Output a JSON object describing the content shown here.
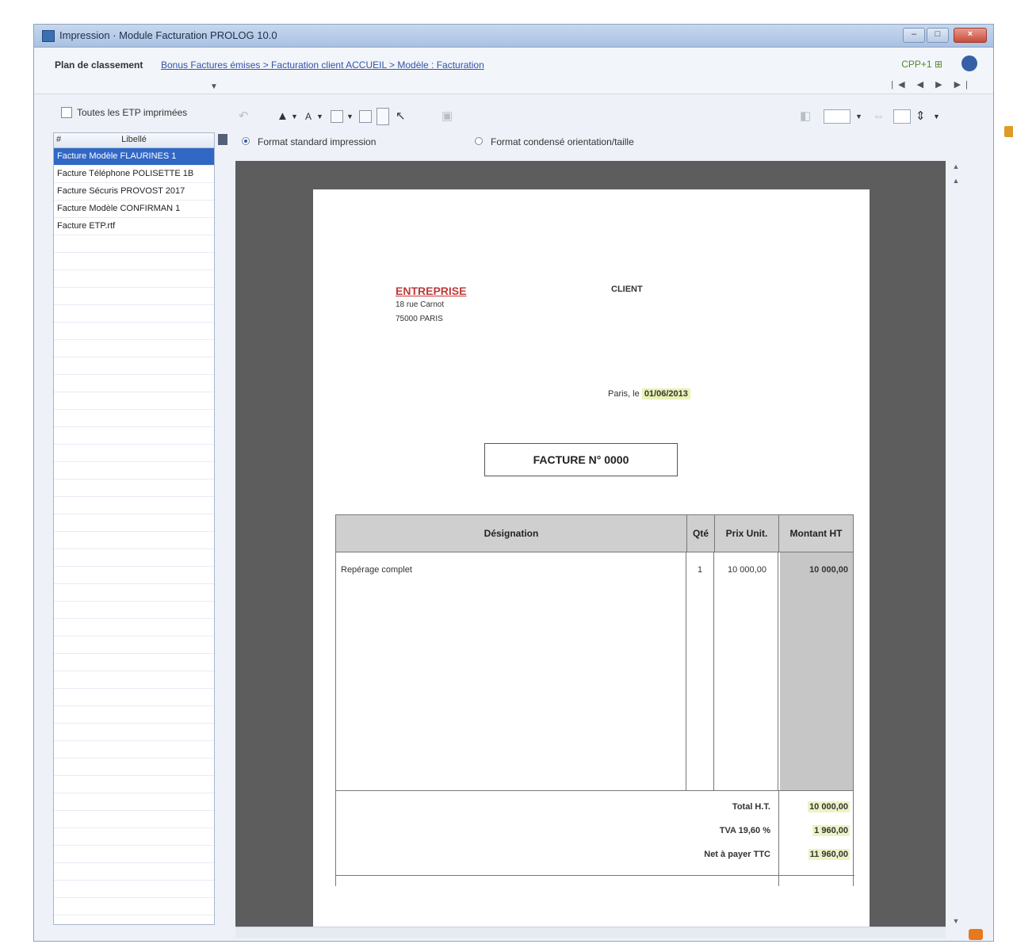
{
  "window": {
    "title": "Impression · Module Facturation PROLOG 10.0",
    "min_glyph": "–",
    "max_glyph": "□",
    "close_glyph": "×"
  },
  "topbar": {
    "label": "Plan de classement",
    "links": "Bonus Factures émises > Facturation client ACCUEIL > Modèle : Facturation",
    "right_text": "CPP+1 ⊞",
    "pager": "|◀ ◀ ▶ ▶|"
  },
  "sidebar": {
    "checkbox_label": "Toutes les ETP imprimées",
    "checkbox_checked": false,
    "header_index": "#",
    "header_label": "Libellé",
    "items": [
      {
        "label": "Facture Modèle FLAURINES 1",
        "selected": true
      },
      {
        "label": "Facture Téléphone POLISETTE 1B",
        "selected": false
      },
      {
        "label": "Facture Sécuris PROVOST 2017",
        "selected": false
      },
      {
        "label": "Facture Modèle CONFIRMAN 1",
        "selected": false
      },
      {
        "label": "Facture ETP.rtf",
        "selected": false
      }
    ]
  },
  "toolbar": {
    "radio1_label": "Format standard impression",
    "radio2_label": "Format condensé orientation/taille",
    "radio1_selected": true
  },
  "document": {
    "company_name": "ENTREPRISE",
    "company_addr1": "18 rue Carnot",
    "company_addr2": "75000 PARIS",
    "client_label": "CLIENT",
    "city_prefix": "Paris, le",
    "date": "01/06/2013",
    "invoice_title": "FACTURE N° 0000",
    "table": {
      "headers": [
        "Désignation",
        "Qté",
        "Prix Unit.",
        "Montant HT"
      ],
      "rows": [
        {
          "designation": "Repérage complet",
          "qty": "1",
          "unit_price": "10 000,00",
          "amount": "10 000,00"
        }
      ]
    },
    "totals": [
      {
        "label": "Total H.T.",
        "value": "10 000,00"
      },
      {
        "label": "TVA 19,60 %",
        "value": "1 960,00"
      },
      {
        "label": "Net à payer TTC",
        "value": "11 960,00"
      }
    ]
  }
}
